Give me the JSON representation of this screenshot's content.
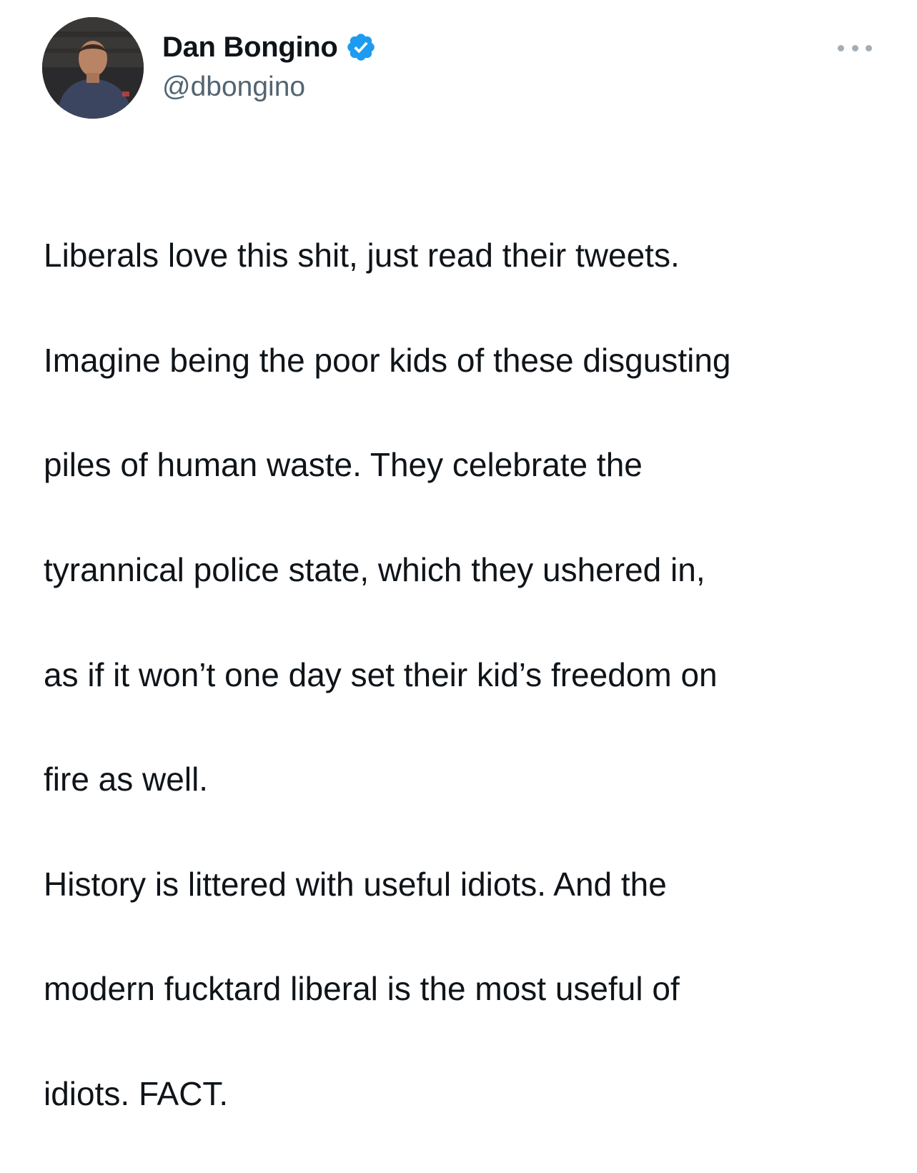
{
  "author": {
    "display_name": "Dan Bongino",
    "handle": "@dbongino",
    "verified": true,
    "verified_color": "#1d9bf0",
    "avatar_icon": "profile-photo"
  },
  "more_menu_icon": "more-options-icon",
  "tweet": {
    "lines": [
      "Liberals love this shit, just read their tweets.",
      "Imagine being the poor kids of these disgusting",
      "piles of human waste. They celebrate the",
      "tyrannical police state, which they ushered in,",
      "as if it won’t one day set their kid’s freedom on",
      "fire as well.",
      "History is littered with useful idiots. And the",
      "modern fucktard liberal is the most useful of",
      "idiots. FACT."
    ]
  },
  "colors": {
    "text_primary": "#0f1419",
    "text_secondary": "#536471",
    "background": "#ffffff"
  }
}
